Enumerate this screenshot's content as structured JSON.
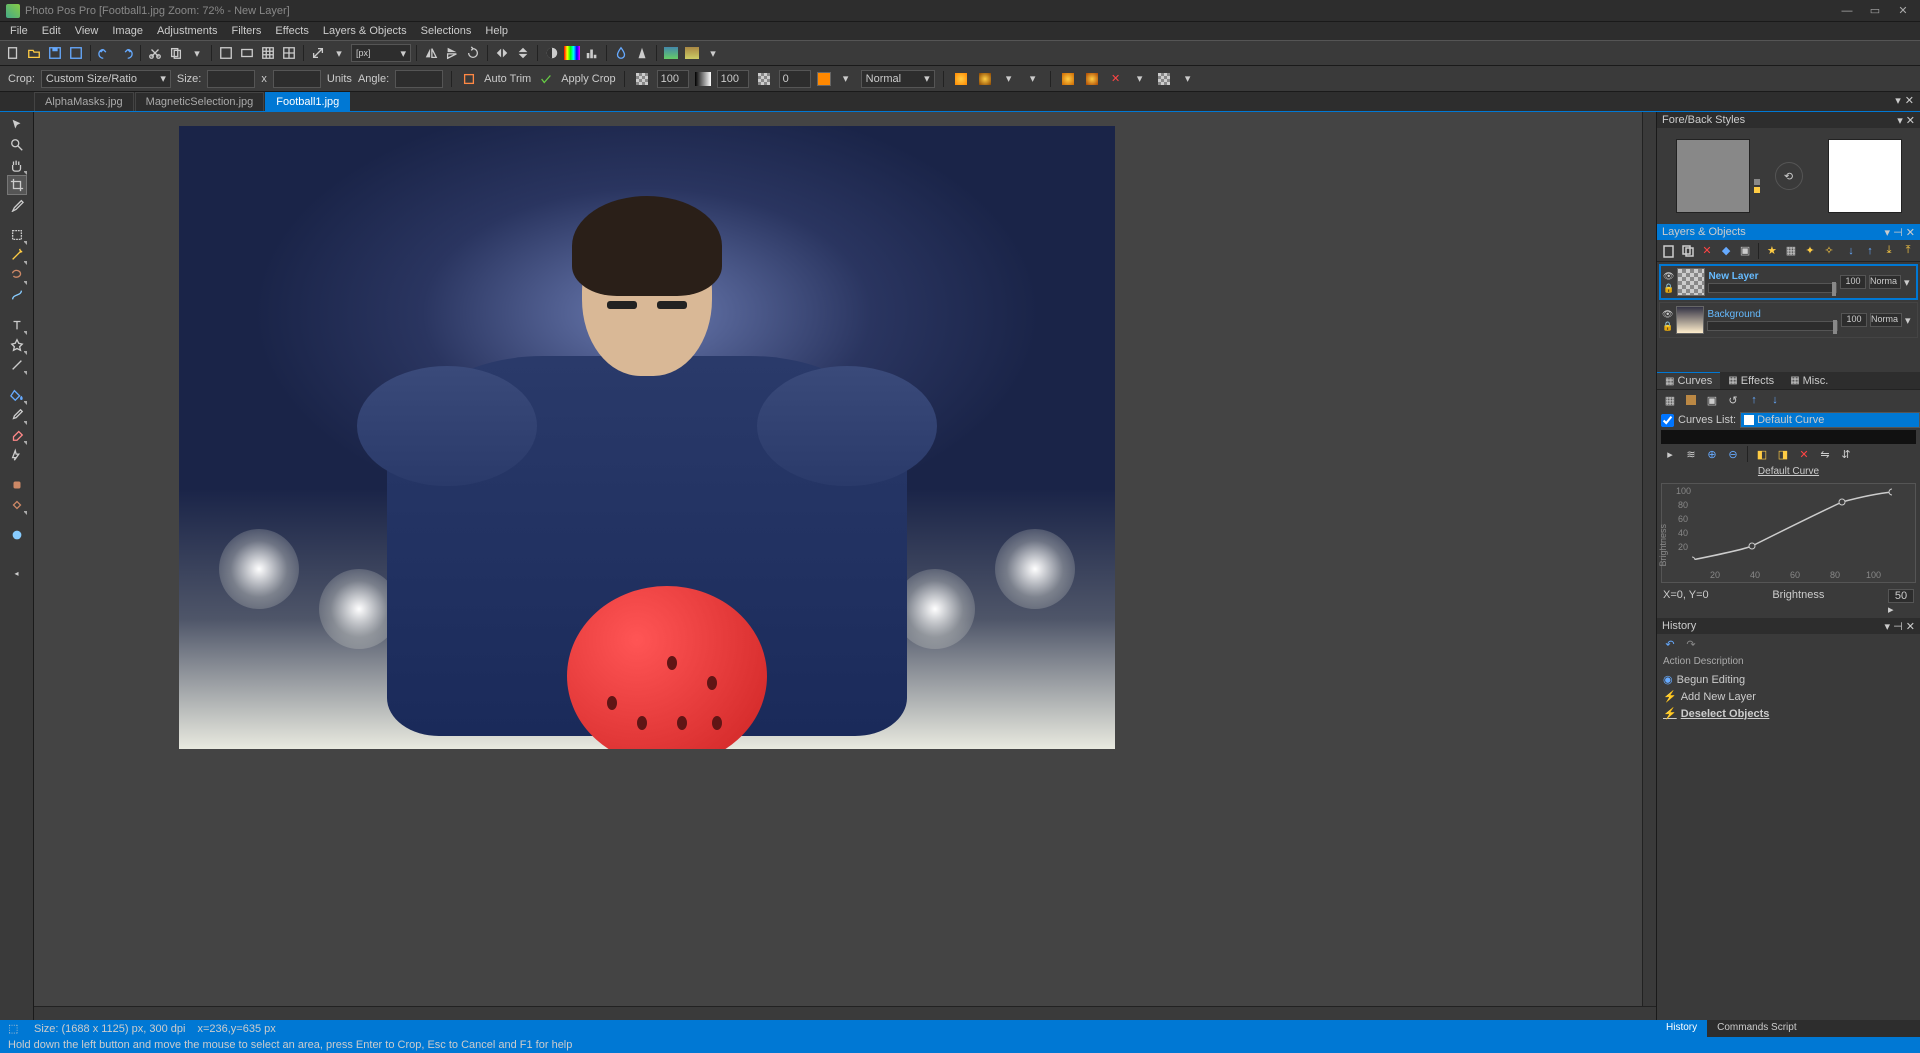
{
  "title": "Photo Pos Pro [Football1.jpg Zoom: 72% - New Layer]",
  "menu": [
    "File",
    "Edit",
    "View",
    "Image",
    "Adjustments",
    "Filters",
    "Effects",
    "Layers & Objects",
    "Selections",
    "Help"
  ],
  "toolbar2": {
    "crop_label": "Crop:",
    "crop_mode": "Custom Size/Ratio",
    "size_label": "Size:",
    "x": "x",
    "units_label": "Units",
    "angle_label": "Angle:",
    "autotrim": "Auto Trim",
    "applycrop": "Apply Crop",
    "val1": "100",
    "val2": "100",
    "val3": "0",
    "blend": "Normal"
  },
  "doctabs": [
    {
      "label": "AlphaMasks.jpg",
      "active": false
    },
    {
      "label": "MagneticSelection.jpg",
      "active": false
    },
    {
      "label": "Football1.jpg",
      "active": true
    }
  ],
  "panels": {
    "forestyles": "Fore/Back Styles",
    "layers": "Layers & Objects",
    "curves_tab": "Curves",
    "effects_tab": "Effects",
    "misc_tab": "Misc.",
    "curves_list": "Curves List:",
    "default_curve": "Default Curve",
    "curve_title": "Default Curve",
    "ylabel": "Brightness",
    "coords": "X=0, Y=0",
    "xlabel": "Brightness",
    "curve_input": "50",
    "history": "History",
    "action_desc": "Action Description",
    "bottom_history": "History",
    "bottom_script": "Commands Script"
  },
  "layers": [
    {
      "name": "New Layer",
      "opacity": "100",
      "mode": "Norma",
      "selected": true,
      "bg": false
    },
    {
      "name": "Background",
      "opacity": "100",
      "mode": "Norma",
      "selected": false,
      "bg": true
    }
  ],
  "history_items": [
    {
      "label": "Begun Editing",
      "icon": "circle",
      "current": false
    },
    {
      "label": "Add New Layer",
      "icon": "bolt",
      "current": false
    },
    {
      "label": "Deselect Objects",
      "icon": "bolt",
      "current": true
    }
  ],
  "status": {
    "size": "Size: (1688 x 1125) px, 300 dpi",
    "pos": "x=236,y=635 px"
  },
  "hint": "Hold down the left button and move the mouse to select an area, press Enter to Crop, Esc to Cancel and F1 for help",
  "chart_data": {
    "type": "line",
    "title": "Default Curve",
    "xlabel": "Brightness",
    "ylabel": "Brightness",
    "xlim": [
      0,
      100
    ],
    "ylim": [
      0,
      100
    ],
    "xticks": [
      20,
      40,
      60,
      80,
      100
    ],
    "yticks": [
      20,
      40,
      60,
      80,
      100
    ],
    "points": [
      [
        0,
        0
      ],
      [
        30,
        20
      ],
      [
        75,
        80
      ],
      [
        100,
        100
      ]
    ]
  }
}
